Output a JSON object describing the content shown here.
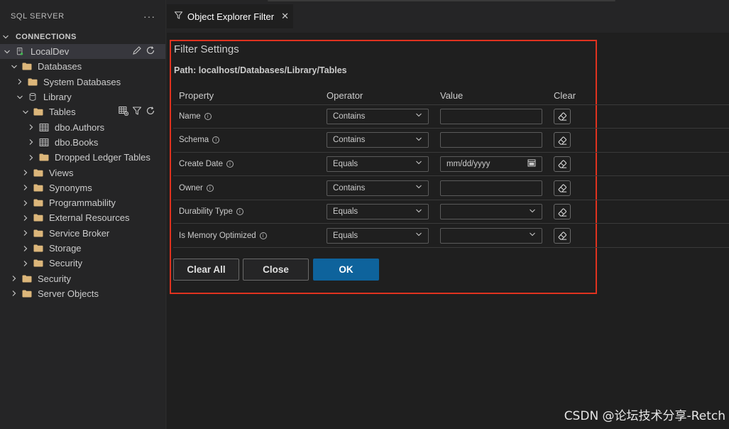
{
  "sidebar": {
    "title": "SQL SERVER",
    "more": "···",
    "section": "CONNECTIONS",
    "tree": [
      {
        "label": "LocalDev",
        "level": 0,
        "chevron": "down",
        "icon": "server-icon",
        "selected": true
      },
      {
        "label": "Databases",
        "level": 1,
        "chevron": "down",
        "icon": "folder-icon"
      },
      {
        "label": "System Databases",
        "level": 2,
        "chevron": "right",
        "icon": "folder-icon"
      },
      {
        "label": "Library",
        "level": 2,
        "chevron": "down",
        "icon": "database-icon"
      },
      {
        "label": "Tables",
        "level": 3,
        "chevron": "down",
        "icon": "folder-icon"
      },
      {
        "label": "dbo.Authors",
        "level": 4,
        "chevron": "right",
        "icon": "table-icon"
      },
      {
        "label": "dbo.Books",
        "level": 4,
        "chevron": "right",
        "icon": "table-icon"
      },
      {
        "label": "Dropped Ledger Tables",
        "level": 4,
        "chevron": "right",
        "icon": "folder-icon"
      },
      {
        "label": "Views",
        "level": 3,
        "chevron": "right",
        "icon": "folder-icon"
      },
      {
        "label": "Synonyms",
        "level": 3,
        "chevron": "right",
        "icon": "folder-icon"
      },
      {
        "label": "Programmability",
        "level": 3,
        "chevron": "right",
        "icon": "folder-icon"
      },
      {
        "label": "External Resources",
        "level": 3,
        "chevron": "right",
        "icon": "folder-icon"
      },
      {
        "label": "Service Broker",
        "level": 3,
        "chevron": "right",
        "icon": "folder-icon"
      },
      {
        "label": "Storage",
        "level": 3,
        "chevron": "right",
        "icon": "folder-icon"
      },
      {
        "label": "Security",
        "level": 3,
        "chevron": "right",
        "icon": "folder-icon"
      },
      {
        "label": "Security",
        "level": 1,
        "chevron": "right",
        "icon": "folder-icon"
      },
      {
        "label": "Server Objects",
        "level": 1,
        "chevron": "right",
        "icon": "folder-icon"
      }
    ]
  },
  "tab": {
    "label": "Object Explorer Filter",
    "icon": "filter-icon",
    "close": "✕"
  },
  "filter": {
    "title": "Filter Settings",
    "path": "Path: localhost/Databases/Library/Tables",
    "headers": {
      "property": "Property",
      "operator": "Operator",
      "value": "Value",
      "clear": "Clear"
    },
    "rows": [
      {
        "property": "Name",
        "operator": "Contains",
        "value": "",
        "value_type": "text"
      },
      {
        "property": "Schema",
        "operator": "Contains",
        "value": "",
        "value_type": "text"
      },
      {
        "property": "Create Date",
        "operator": "Equals",
        "value": "mm/dd/yyyy",
        "value_type": "date"
      },
      {
        "property": "Owner",
        "operator": "Contains",
        "value": "",
        "value_type": "text"
      },
      {
        "property": "Durability Type",
        "operator": "Equals",
        "value": "",
        "value_type": "select"
      },
      {
        "property": "Is Memory Optimized",
        "operator": "Equals",
        "value": "",
        "value_type": "select"
      }
    ],
    "buttons": {
      "clear_all": "Clear All",
      "close": "Close",
      "ok": "OK"
    }
  },
  "colors": {
    "accent": "#0e639c",
    "highlight_border": "#e0321f",
    "folder": "#dcb67a",
    "status_green": "#3fb950"
  },
  "watermark": "CSDN @论坛技术分享-Retch"
}
